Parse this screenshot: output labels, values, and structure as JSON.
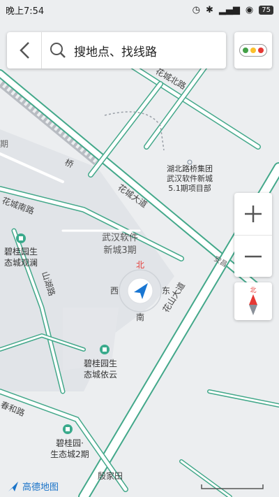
{
  "status": {
    "time": "晚上7:54",
    "battery": "75"
  },
  "search": {
    "placeholder": "搜地点、找线路"
  },
  "traffic": {
    "colors": [
      "#43a047",
      "#fbc02d",
      "#e53935"
    ]
  },
  "map": {
    "labels": {
      "huacheng_north": "花城北路",
      "huacheng_ave": "花城大道",
      "huashan_ave": "花山大道",
      "huacheng_south": "花城南路",
      "shanhu_road": "山湖路",
      "chunhe_road": "春和路",
      "qiao": "桥",
      "anchang": "安昌",
      "poi_hubei": [
        "湖北路桥集团",
        "武汉软件新城",
        "5.1期项目部"
      ],
      "poi_wuhan_sw": [
        "武汉软件",
        "新城3期"
      ],
      "poi_biguiyuan_guanlan": [
        "碧桂园生",
        "态城观澜"
      ],
      "poi_biguiyuan_yiyun": [
        "碧桂园生",
        "态城依云"
      ],
      "poi_biguiyuan_2": [
        "碧桂园·",
        "生态城2期"
      ],
      "yinjiatian": "殷家田",
      "north": "北",
      "south": "南",
      "east": "东",
      "west": "西",
      "edge_left": "期"
    }
  },
  "compass": {
    "north": "北"
  },
  "logo": {
    "text": "高德地图"
  }
}
